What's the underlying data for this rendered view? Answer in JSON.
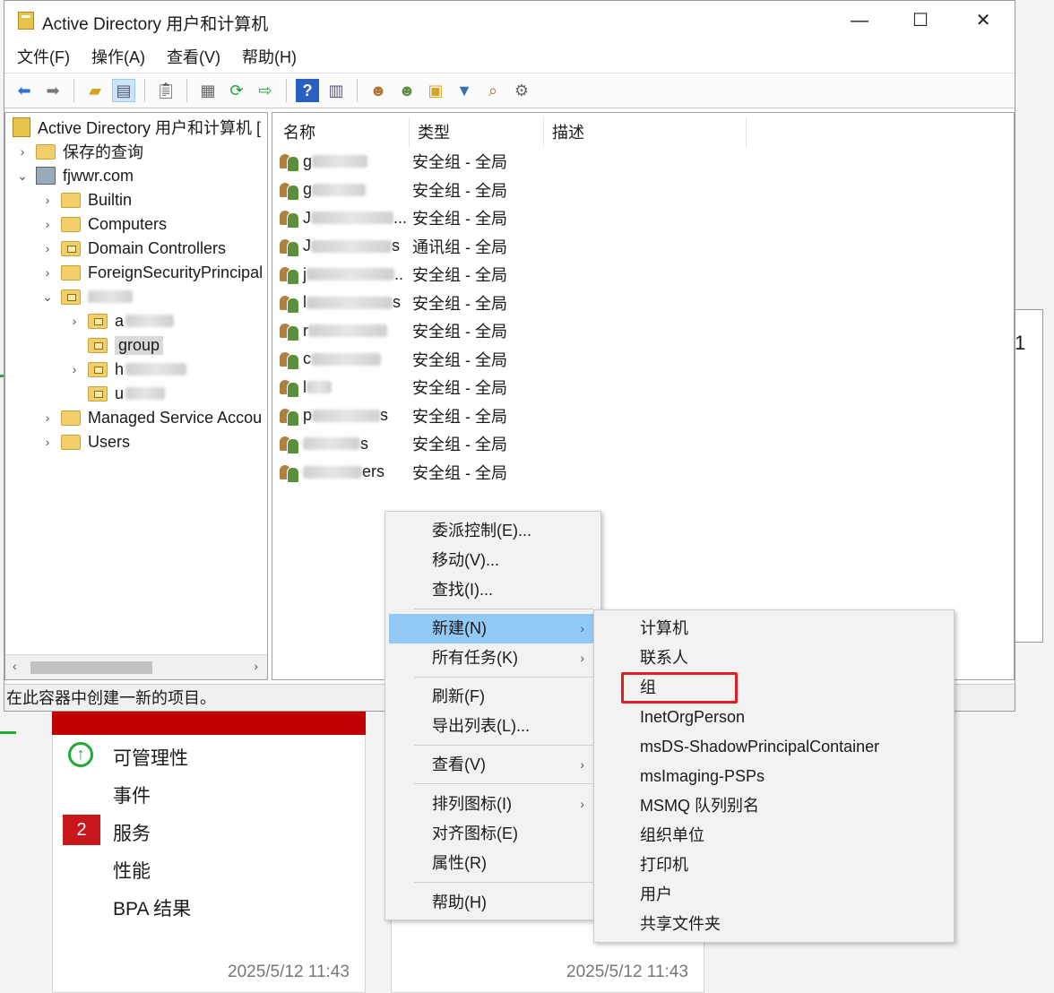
{
  "window": {
    "title": "Active Directory 用户和计算机",
    "controls": {
      "minimize": "—",
      "maximize": "☐",
      "close": "✕"
    }
  },
  "menubar": [
    "文件(F)",
    "操作(A)",
    "查看(V)",
    "帮助(H)"
  ],
  "toolbar_icons": [
    "back-icon",
    "forward-icon",
    "up-folder-icon",
    "show-console-tree-icon",
    "clipboard-icon",
    "properties-icon",
    "refresh-icon",
    "export-list-icon",
    "help-icon",
    "action-pane-icon",
    "new-user-icon",
    "new-group-icon",
    "new-ou-icon",
    "filter-icon",
    "find-icon",
    "add-member-icon"
  ],
  "tree": {
    "root": "Active Directory 用户和计算机 [",
    "saved_queries": "保存的查询",
    "domain": "fjwwr.com",
    "children": [
      "Builtin",
      "Computers",
      "Domain Controllers",
      "ForeignSecurityPrincipal",
      "Managed Service Accou",
      "Users"
    ],
    "ou_children": {
      "a": "a",
      "group": "group",
      "h": "h",
      "u": "u"
    }
  },
  "list": {
    "columns": [
      "名称",
      "类型",
      "描述"
    ],
    "rows": [
      {
        "name_start": "g",
        "name_end": "",
        "type": "安全组 - 全局"
      },
      {
        "name_start": "g",
        "name_end": "",
        "type": "安全组 - 全局"
      },
      {
        "name_start": "J",
        "name_end": "...",
        "type": "安全组 - 全局"
      },
      {
        "name_start": "J",
        "name_end": "s",
        "type": "通讯组 - 全局"
      },
      {
        "name_start": "j",
        "name_end": "..",
        "type": "安全组 - 全局"
      },
      {
        "name_start": "l",
        "name_end": "s",
        "type": "安全组 - 全局"
      },
      {
        "name_start": "r",
        "name_end": "",
        "type": "安全组 - 全局"
      },
      {
        "name_start": "c",
        "name_end": "",
        "type": "安全组 - 全局"
      },
      {
        "name_start": "l",
        "name_end": "",
        "type": "安全组 - 全局"
      },
      {
        "name_start": "p",
        "name_end": "s",
        "type": "安全组 - 全局"
      },
      {
        "name_start": "",
        "name_end": "s",
        "type": "安全组 - 全局"
      },
      {
        "name_start": "",
        "name_end": "ers",
        "type": "安全组 - 全局"
      }
    ]
  },
  "status": "在此容器中创建一新的项目。",
  "context_menu": {
    "items": [
      "委派控制(E)...",
      "移动(V)...",
      "查找(I)...",
      "新建(N)",
      "所有任务(K)",
      "刷新(F)",
      "导出列表(L)...",
      "查看(V)",
      "排列图标(I)",
      "对齐图标(E)",
      "属性(R)",
      "帮助(H)"
    ],
    "highlighted": "新建(N)"
  },
  "submenu": {
    "items": [
      "计算机",
      "联系人",
      "组",
      "InetOrgPerson",
      "msDS-ShadowPrincipalContainer",
      "msImaging-PSPs",
      "MSMQ 队列别名",
      "组织单位",
      "打印机",
      "用户",
      "共享文件夹"
    ],
    "marked": "组"
  },
  "background": {
    "rows": [
      "可管理性",
      "事件",
      "服务",
      "性能",
      "BPA 结果"
    ],
    "badge": "2",
    "count": "1",
    "timestamps": [
      "2025/5/12 11:43",
      "2025/5/12 11:43"
    ]
  },
  "colors": {
    "highlight": "#91c9f7",
    "annotation_red": "#e31b23",
    "alert_red": "#c8161d",
    "ok_green": "#1faa3a"
  }
}
